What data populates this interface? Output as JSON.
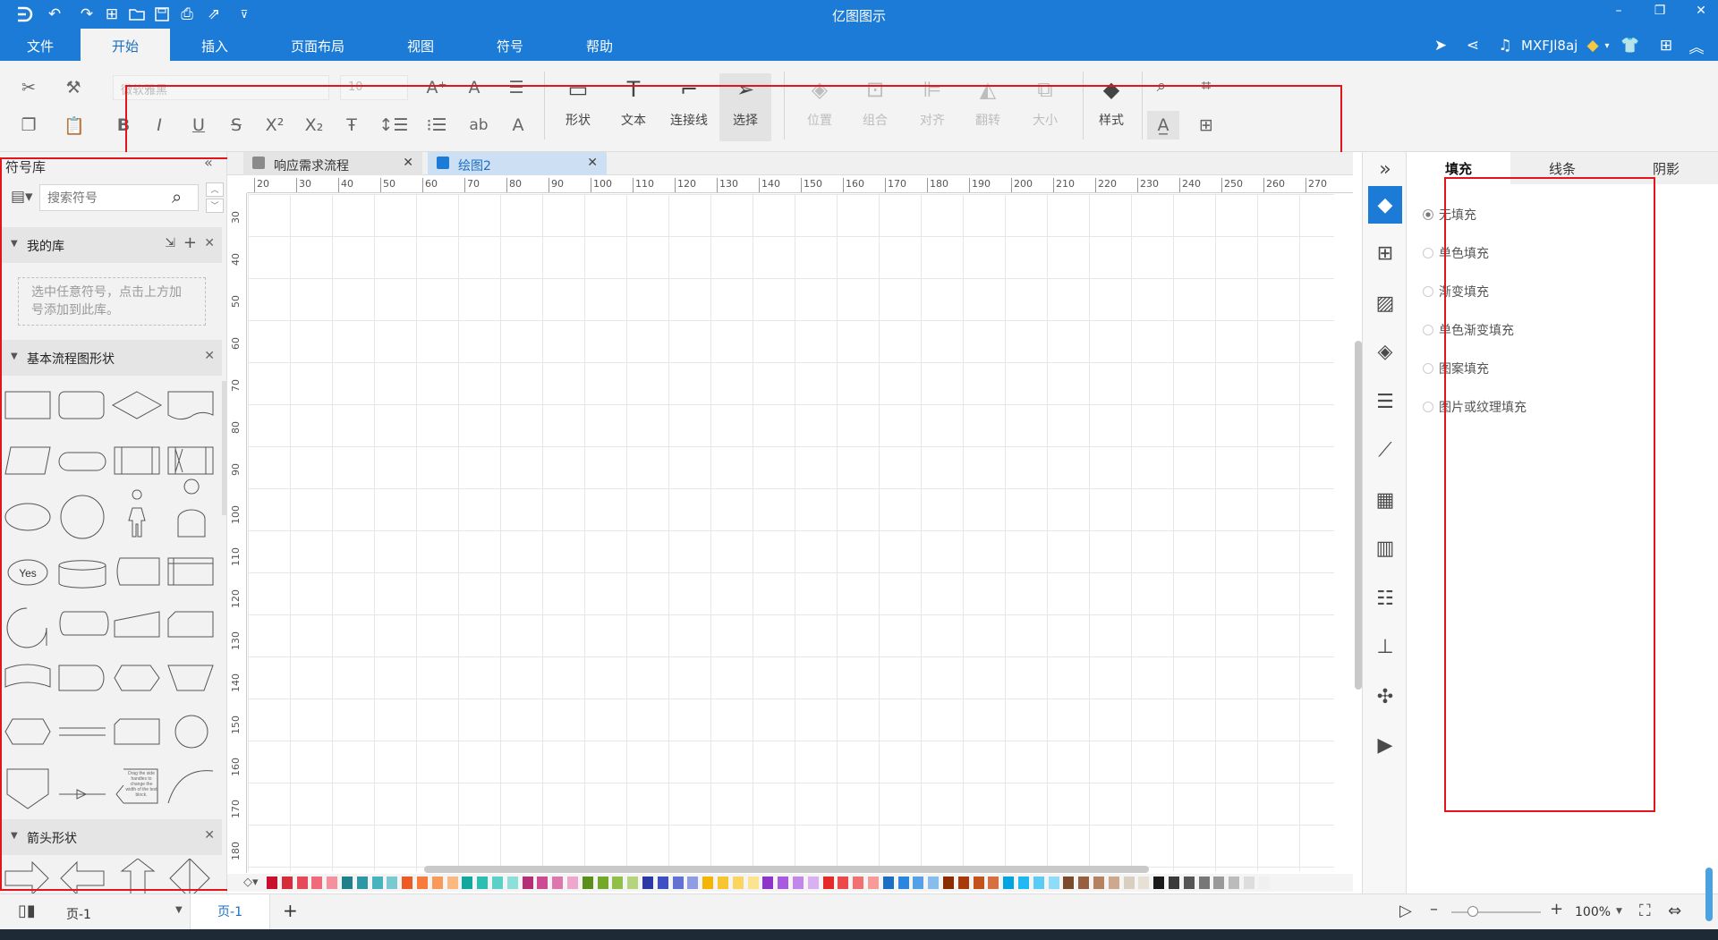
{
  "app": {
    "title": "亿图图示"
  },
  "quick_access": [
    "app-logo-icon",
    "undo-icon",
    "redo-icon",
    "new-file-icon",
    "open-folder-icon",
    "save-icon",
    "print-icon",
    "export-icon",
    "customize-icon"
  ],
  "menu": {
    "items": [
      "文件",
      "开始",
      "插入",
      "页面布局",
      "视图",
      "符号",
      "帮助"
    ],
    "active": "开始"
  },
  "user": {
    "name": "MXFJl8aj"
  },
  "ribbon": {
    "font_name": "微软雅黑",
    "font_size": "10",
    "tools": {
      "shape": "形状",
      "text": "文本",
      "connector": "连接线",
      "select": "选择",
      "position": "位置",
      "group": "组合",
      "align": "对齐",
      "flip": "翻转",
      "size": "大小",
      "style": "样式"
    }
  },
  "left_panel": {
    "title": "符号库",
    "search_placeholder": "搜索符号",
    "sections": {
      "my_library": "我的库",
      "basic_flowchart": "基本流程图形状",
      "arrows": "箭头形状"
    },
    "my_library_hint": "选中任意符号，点击上方加号添加到此库。",
    "shape_yes_label": "Yes",
    "shape_note_text": "Drag the side handles to change the width of the text block."
  },
  "document_tabs": [
    {
      "label": "响应需求流程",
      "active": false
    },
    {
      "label": "绘图2",
      "active": true
    }
  ],
  "rulers": {
    "horizontal": [
      "20",
      "30",
      "40",
      "50",
      "60",
      "70",
      "80",
      "90",
      "100",
      "110",
      "120",
      "130",
      "140",
      "150",
      "160",
      "170",
      "180",
      "190",
      "200",
      "210",
      "220",
      "230",
      "240",
      "250",
      "260",
      "270"
    ],
    "vertical": [
      "30",
      "40",
      "50",
      "60",
      "70",
      "80",
      "90",
      "100",
      "110",
      "120",
      "130",
      "140",
      "150",
      "160",
      "170",
      "180"
    ]
  },
  "right_panel": {
    "tabs": [
      "填充",
      "线条",
      "阴影"
    ],
    "active_tab": "填充",
    "fill_options": [
      "无填充",
      "单色填充",
      "渐变填充",
      "单色渐变填充",
      "图案填充",
      "图片或纹理填充"
    ],
    "selected_fill": "无填充"
  },
  "right_icons": [
    "collapse-right-icon",
    "fill-icon",
    "grid-apps-icon",
    "image-icon",
    "layers-icon",
    "page-props-icon",
    "chart-icon",
    "table-icon",
    "data-icon",
    "gantt-icon",
    "org-chart-icon",
    "mindmap-icon",
    "presentation-icon"
  ],
  "status": {
    "page_selector": "页-1",
    "page_tab": "页-1",
    "zoom": "100%"
  },
  "palette": [
    "#c8102e",
    "#d62c3c",
    "#e64a5a",
    "#f06a79",
    "#f4919c",
    "#1f7f8a",
    "#2c98a5",
    "#46b3bf",
    "#79c9d1",
    "#ee5a24",
    "#f77b3a",
    "#f99a5b",
    "#fbb982",
    "#13a89e",
    "#2bbfb4",
    "#5ad0c7",
    "#8de0d9",
    "#b52f76",
    "#cc4b92",
    "#de77ae",
    "#eda7cb",
    "#5a8f1a",
    "#72a92a",
    "#90c04a",
    "#b4d47e",
    "#2a38a8",
    "#3d4fc4",
    "#6172d4",
    "#8f9ce3",
    "#f5b400",
    "#f8c530",
    "#fad560",
    "#fce38f",
    "#8e35c9",
    "#a85be0",
    "#c287ea",
    "#d9b1f2",
    "#e52929",
    "#ec4a4a",
    "#f27070",
    "#f79a9a",
    "#1a6fc4",
    "#2d86dd",
    "#56a1e6",
    "#86bdee",
    "#8a2c00",
    "#a83a0a",
    "#c4521c",
    "#d77040",
    "#00a4e0",
    "#20b8f0",
    "#58ccf5",
    "#8fdcf8",
    "#7a4b2a",
    "#966040",
    "#b5815e",
    "#cda88c",
    "#d9cfc0",
    "#e8e0d4",
    "#1a1a1a",
    "#3a3a3a",
    "#555555",
    "#777777",
    "#999999",
    "#bbbbbb",
    "#dddddd",
    "#f0f0f0"
  ]
}
